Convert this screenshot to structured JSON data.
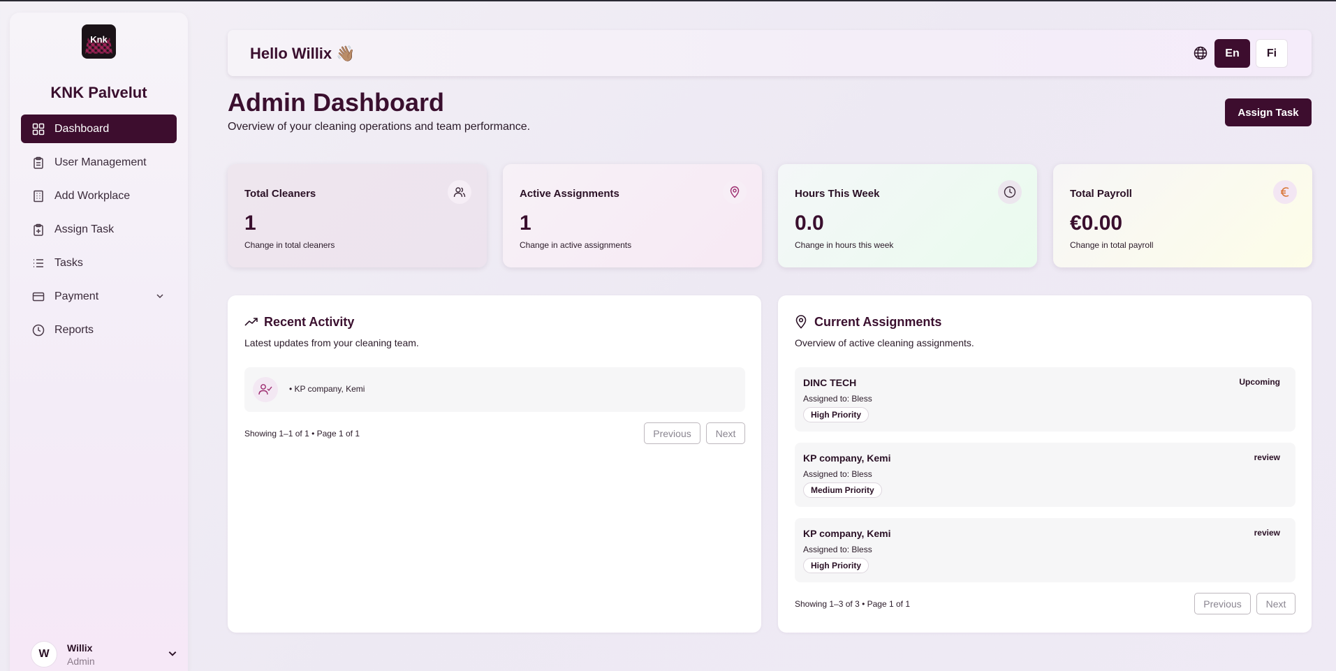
{
  "sidebar": {
    "logo_text": "Knk",
    "brand": "KNK Palvelut",
    "items": [
      {
        "label": "Dashboard",
        "icon": "dashboard-icon",
        "active": true
      },
      {
        "label": "User Management",
        "icon": "clipboard-icon"
      },
      {
        "label": "Add Workplace",
        "icon": "building-icon"
      },
      {
        "label": "Assign Task",
        "icon": "clipboard-plus-icon"
      },
      {
        "label": "Tasks",
        "icon": "list-icon"
      },
      {
        "label": "Payment",
        "icon": "credit-card-icon",
        "has_submenu": true
      },
      {
        "label": "Reports",
        "icon": "clock-icon"
      }
    ],
    "user": {
      "initial": "W",
      "name": "Willix",
      "role": "Admin"
    }
  },
  "header": {
    "greeting": "Hello Willix 👋🏽",
    "languages": [
      "En",
      "Fi"
    ],
    "active_language": "En"
  },
  "page": {
    "title": "Admin Dashboard",
    "subtitle": "Overview of your cleaning operations and team performance.",
    "assign_button": "Assign Task"
  },
  "stats": [
    {
      "label": "Total Cleaners",
      "value": "1",
      "change": "Change in total cleaners",
      "icon": "users-icon"
    },
    {
      "label": "Active Assignments",
      "value": "1",
      "change": "Change in active assignments",
      "icon": "map-pin-icon"
    },
    {
      "label": "Hours This Week",
      "value": "0.0",
      "change": "Change in hours this week",
      "icon": "clock-icon"
    },
    {
      "label": "Total Payroll",
      "value": "€0.00",
      "change": "Change in total payroll",
      "icon": "euro-icon"
    }
  ],
  "recent_activity": {
    "title": "Recent Activity",
    "subtitle": "Latest updates from your cleaning team.",
    "items": [
      {
        "text": "• KP company, Kemi"
      }
    ],
    "pager": {
      "text": "Showing 1–1 of 1 • Page 1 of 1",
      "previous": "Previous",
      "next": "Next"
    }
  },
  "current_assignments": {
    "title": "Current Assignments",
    "subtitle": "Overview of active cleaning assignments.",
    "items": [
      {
        "name": "DINC TECH",
        "assigned": "Assigned to: Bless",
        "priority": "High Priority",
        "status": "Upcoming"
      },
      {
        "name": "KP company, Kemi",
        "assigned": "Assigned to: Bless",
        "priority": "Medium Priority",
        "status": "review"
      },
      {
        "name": "KP company, Kemi",
        "assigned": "Assigned to: Bless",
        "priority": "High Priority",
        "status": "review"
      }
    ],
    "pager": {
      "text": "Showing 1–3 of 3 • Page 1 of 1",
      "previous": "Previous",
      "next": "Next"
    }
  },
  "colors": {
    "primary": "#3d0d2e",
    "accent_icon": "#9c2a6e",
    "euro_icon": "#d9783a"
  }
}
